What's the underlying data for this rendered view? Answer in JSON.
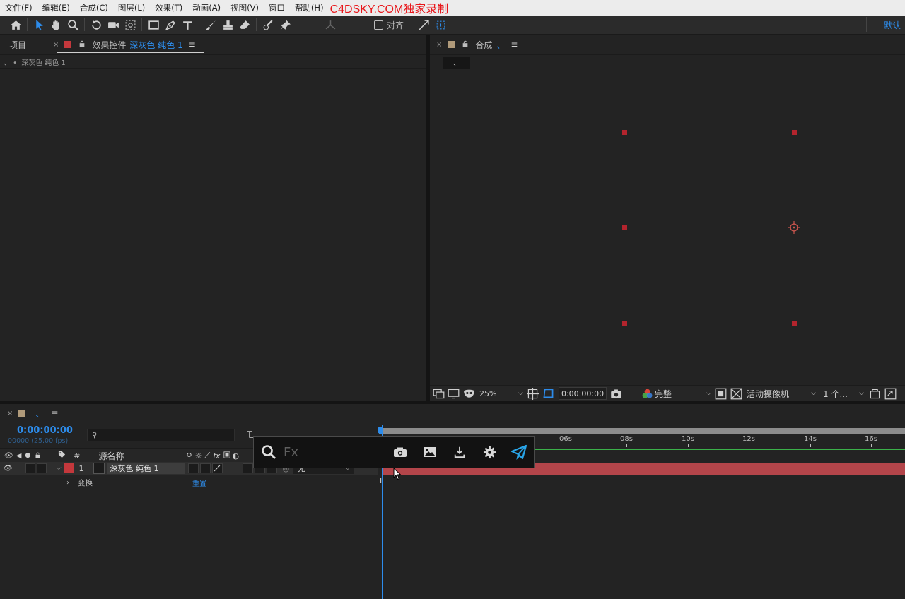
{
  "menu": {
    "items": [
      "文件(F)",
      "编辑(E)",
      "合成(C)",
      "图层(L)",
      "效果(T)",
      "动画(A)",
      "视图(V)",
      "窗口",
      "帮助(H)"
    ],
    "watermark": "C4DSKY.COM独家录制"
  },
  "toolbar": {
    "align_label": "对齐",
    "workspace": "默认"
  },
  "left_panel": {
    "tab_project": "项目",
    "tab_effects": "效果控件",
    "tab_effects_layer": "深灰色 纯色 1",
    "breadcrumb_prefix": "、 •",
    "breadcrumb_layer": "深灰色 纯色 1"
  },
  "comp_panel": {
    "tab_label": "合成",
    "tab_name": "、",
    "subtab": "、",
    "zoom": "25%",
    "timecode": "0:00:00:00",
    "resolution": "完整",
    "camera": "活动摄像机",
    "views": "1 个..."
  },
  "timeline": {
    "tab_name": "、",
    "timecode": "0:00:00:00",
    "fps": "00000 (25.00 fps)",
    "col_num": "#",
    "col_source": "源名称",
    "layer_num": "1",
    "layer_name": "深灰色 纯色 1",
    "parent_value": "无",
    "transform_label": "变换",
    "reset_label": "重置",
    "ticks": [
      "06s",
      "08s",
      "10s",
      "12s",
      "14s",
      "16s"
    ],
    "cursor_glyph": "I"
  },
  "popup": {
    "placeholder": "Fx"
  },
  "colors": {
    "accent": "#2d8ceb",
    "layer_label": "#c4383c",
    "handle": "#b3242d"
  }
}
